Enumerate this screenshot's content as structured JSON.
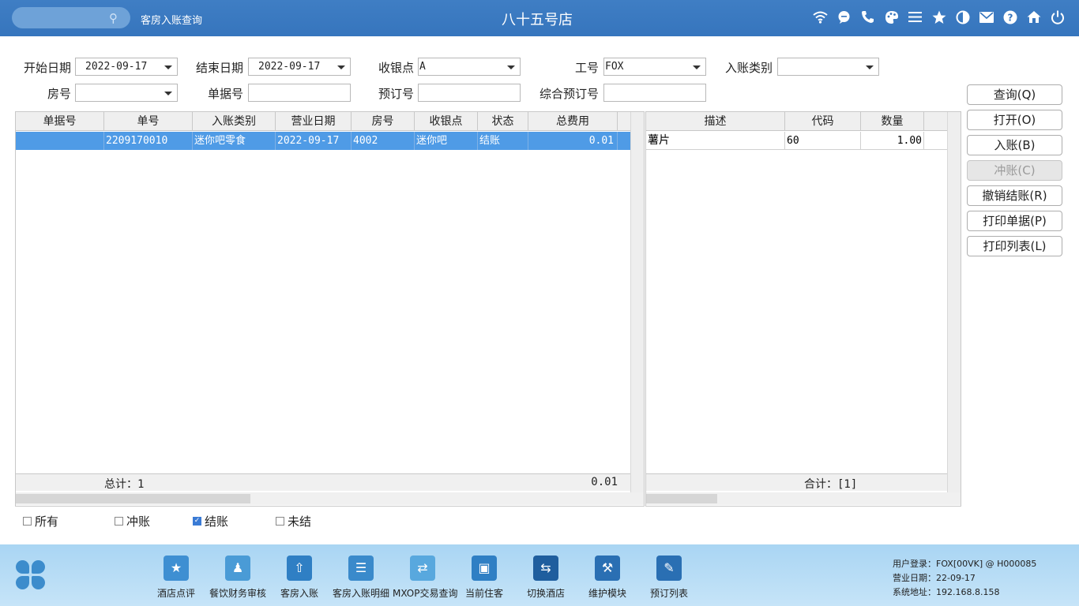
{
  "header": {
    "module_title": "客房入账查询",
    "hotel_name": "八十五号店",
    "icons": [
      "wifi-icon",
      "chat-icon",
      "phone-icon",
      "palette-icon",
      "menu-icon",
      "star-icon",
      "contrast-icon",
      "mail-icon",
      "help-icon",
      "home-icon",
      "power-icon"
    ]
  },
  "filters": {
    "start_date_label": "开始日期",
    "start_date": "2022-09-17",
    "end_date_label": "结束日期",
    "end_date": "2022-09-17",
    "cashier_label": "收银点",
    "cashier": "A",
    "staff_label": "工号",
    "staff": "FOX",
    "entry_type_label": "入账类别",
    "entry_type": "",
    "room_label": "房号",
    "room": "",
    "voucher_label": "单据号",
    "voucher": "",
    "booking_label": "预订号",
    "booking": "",
    "group_booking_label": "综合预订号",
    "group_booking": ""
  },
  "main_table": {
    "columns": [
      "单据号",
      "单号",
      "入账类别",
      "营业日期",
      "房号",
      "收银点",
      "状态",
      "总费用"
    ],
    "rows": [
      {
        "voucher": "",
        "number": "2209170010",
        "type": "迷你吧零食",
        "date": "2022-09-17",
        "room": "4002",
        "cashier": "迷你吧",
        "status": "结账",
        "total": "0.01"
      }
    ],
    "footer_label": "总计：1",
    "footer_total": "0.01"
  },
  "detail_table": {
    "columns": [
      "描述",
      "代码",
      "数量"
    ],
    "rows": [
      {
        "desc": "薯片",
        "code": "60",
        "qty": "1.00"
      }
    ],
    "footer_label": "合计：[1]"
  },
  "buttons": {
    "query": "查询(Q)",
    "open": "打开(O)",
    "post": "入账(B)",
    "reverse": "冲账(C)",
    "cancel_checkout": "撤销结账(R)",
    "print_voucher": "打印单据(P)",
    "print_list": "打印列表(L)"
  },
  "checkboxes": {
    "all": {
      "label": "所有",
      "checked": false
    },
    "reversed": {
      "label": "冲账",
      "checked": false
    },
    "settled": {
      "label": "结账",
      "checked": true
    },
    "unsettled": {
      "label": "未结",
      "checked": false
    }
  },
  "nav": [
    {
      "label": "酒店点评",
      "icon": "star-badge-icon",
      "color": "#3e8fd2"
    },
    {
      "label": "餐饮财务审核",
      "icon": "user-stamp-icon",
      "color": "#4a9bd6"
    },
    {
      "label": "客房入账",
      "icon": "house-upload-icon",
      "color": "#2f7fc4"
    },
    {
      "label": "客房入账明细",
      "icon": "receipt-icon",
      "color": "#3a8acb"
    },
    {
      "label": "MXOP交易查询",
      "icon": "exchange-coin-icon",
      "color": "#58a8de"
    },
    {
      "label": "当前住客",
      "icon": "id-card-icon",
      "color": "#2f7fc4"
    },
    {
      "label": "切换酒店",
      "icon": "switch-icon",
      "color": "#1f5e9e"
    },
    {
      "label": "维护模块",
      "icon": "wrench-icon",
      "color": "#2a6fb3"
    },
    {
      "label": "预订列表",
      "icon": "document-edit-icon",
      "color": "#2a6fb3"
    }
  ],
  "info": {
    "user_label": "用户登录：",
    "user": "FOX[00VK] @ H000085",
    "biz_date_label": "营业日期：",
    "biz_date": "22-09-17",
    "address_label": "系统地址：",
    "address": "192.168.8.158"
  },
  "colors": {
    "topbar": "#3675bd",
    "selection": "#4f9be6",
    "bottombar": "#b8dcf5"
  }
}
